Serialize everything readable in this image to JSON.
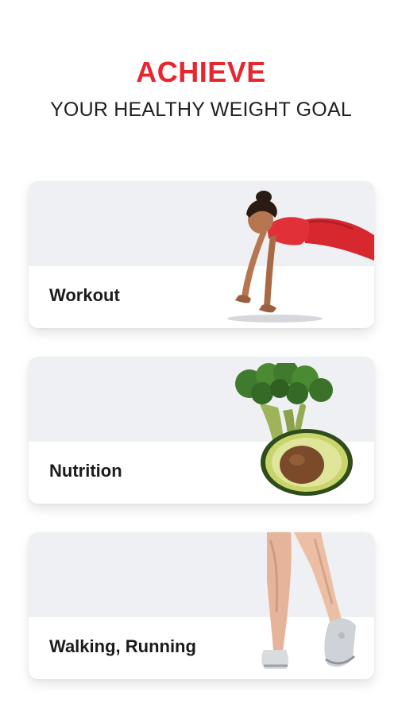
{
  "header": {
    "title": "ACHIEVE",
    "subtitle": "YOUR HEALTHY WEIGHT GOAL"
  },
  "colors": {
    "accent": "#e8262e",
    "card_top": "#eef0f4",
    "text": "#1b1b1b"
  },
  "cards": [
    {
      "label": "Workout",
      "icon": "pushup-woman-icon"
    },
    {
      "label": "Nutrition",
      "icon": "broccoli-avocado-icon"
    },
    {
      "label": "Walking, Running",
      "icon": "walking-legs-icon"
    }
  ]
}
